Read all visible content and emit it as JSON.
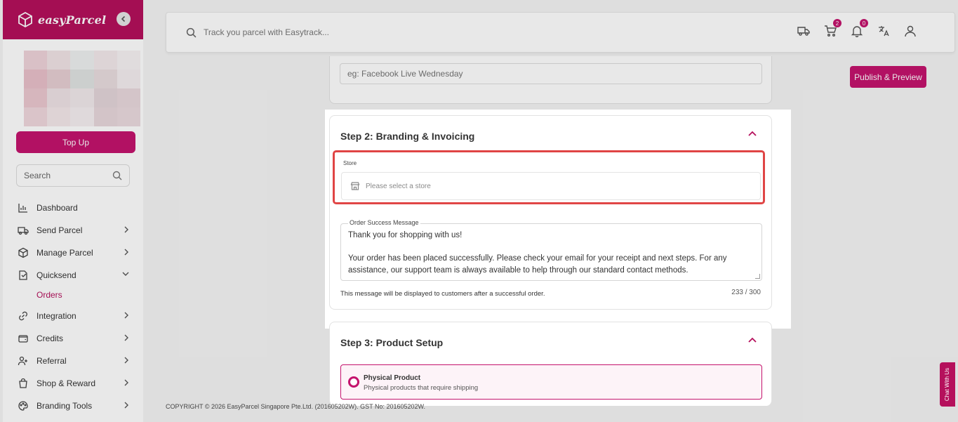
{
  "brand": {
    "name": "easyParcel"
  },
  "sidebar": {
    "topup_label": "Top Up",
    "search_placeholder": "Search",
    "items": [
      {
        "label": "Dashboard",
        "icon": "dashboard-icon",
        "chevron": ""
      },
      {
        "label": "Send Parcel",
        "icon": "truck-icon",
        "chevron": "right"
      },
      {
        "label": "Manage Parcel",
        "icon": "box-icon",
        "chevron": "right"
      },
      {
        "label": "Quicksend",
        "icon": "quicksend-icon",
        "chevron": "down"
      },
      {
        "label": "Integration",
        "icon": "link-icon",
        "chevron": "right"
      },
      {
        "label": "Credits",
        "icon": "wallet-icon",
        "chevron": "right"
      },
      {
        "label": "Referral",
        "icon": "referral-icon",
        "chevron": "right"
      },
      {
        "label": "Shop & Reward",
        "icon": "shopping-bag-icon",
        "chevron": "right"
      },
      {
        "label": "Branding Tools",
        "icon": "palette-icon",
        "chevron": "right"
      }
    ],
    "sub_item": "Orders"
  },
  "header": {
    "track_placeholder": "Track you parcel with Easytrack...",
    "cart_badge": "2",
    "bell_badge": "0"
  },
  "main": {
    "publish_label": "Publish & Preview",
    "step1_placeholder": "eg: Facebook Live Wednesday",
    "step2": {
      "title": "Step 2: Branding & Invoicing",
      "store_label": "Store",
      "store_placeholder": "Please select a store",
      "message_label": "Order Success Message",
      "message_value": "Thank you for shopping with us!\n\nYour order has been placed successfully. Please check your email for your receipt and next steps. For any assistance, our support team is always available to help through our standard contact methods.",
      "helper": "This message will be displayed to customers after a successful order.",
      "count": "233 / 300"
    },
    "step3": {
      "title": "Step 3: Product Setup",
      "option_title": "Physical Product",
      "option_desc": "Physical products that require shipping"
    }
  },
  "footer": {
    "copyright": "COPYRIGHT © 2026 EasyParcel Singapore Pte.Ltd. (201605202W). GST No: 201605202W."
  },
  "chat": {
    "label": "Chat With Us"
  },
  "colors": {
    "brand": "#b5105c",
    "accent": "#c4136d",
    "highlight": "#e04545"
  }
}
